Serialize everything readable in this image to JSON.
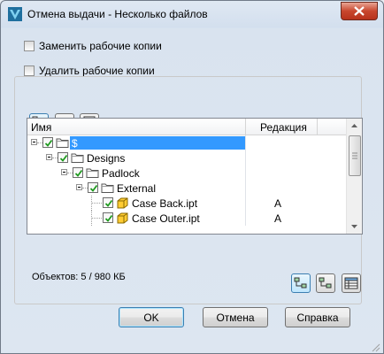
{
  "window": {
    "title": "Отмена выдачи - Несколько файлов",
    "accent": "#3399ff"
  },
  "options": {
    "replace_label": "Заменить рабочие копии",
    "delete_label": "Удалить рабочие копии"
  },
  "grid": {
    "col_name": "Имя",
    "col_revision": "Редакция",
    "rows": [
      {
        "name": "$",
        "revision": "",
        "icon": "folder-icon",
        "level": 0,
        "selected": true
      },
      {
        "name": "Designs",
        "revision": "",
        "icon": "folder-icon",
        "level": 1,
        "selected": false
      },
      {
        "name": "Padlock",
        "revision": "",
        "icon": "folder-icon",
        "level": 2,
        "selected": false
      },
      {
        "name": "External",
        "revision": "",
        "icon": "folder-icon",
        "level": 3,
        "selected": false
      },
      {
        "name": "Case Back.ipt",
        "revision": "A",
        "icon": "part-icon",
        "level": 4,
        "selected": false
      },
      {
        "name": "Case Outer.ipt",
        "revision": "A",
        "icon": "part-icon",
        "level": 4,
        "selected": false
      }
    ]
  },
  "status": {
    "objects": "Объектов: 5 / 980 КБ"
  },
  "buttons": {
    "ok": "OK",
    "cancel": "Отмена",
    "help": "Справка"
  }
}
